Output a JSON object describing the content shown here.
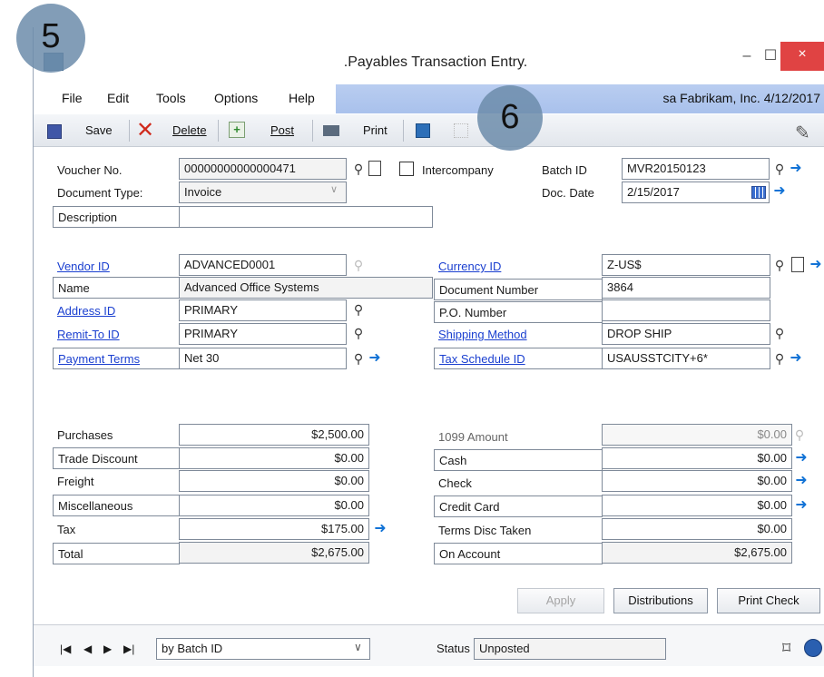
{
  "window": {
    "title": ".Payables Transaction Entry.",
    "minimize": "–",
    "maximize": "☐",
    "close": "×"
  },
  "menu": {
    "items": [
      "File",
      "Edit",
      "Tools",
      "Options",
      "Help"
    ],
    "user_info": "sa  Fabrikam, Inc.  4/12/2017"
  },
  "toolbar": {
    "save": "Save",
    "delete": "Delete",
    "post": "Post",
    "print": "Print"
  },
  "annotations": {
    "badge_a": "5",
    "badge_b": "6"
  },
  "header": {
    "voucher_label": "Voucher No.",
    "voucher_value": "00000000000000471",
    "intercompany_label": "Intercompany",
    "batch_label": "Batch ID",
    "batch_value": "MVR20150123",
    "doctype_label": "Document Type:",
    "doctype_value": "Invoice",
    "docdate_label": "Doc. Date",
    "docdate_value": "2/15/2017",
    "description_label": "Description",
    "description_value": ""
  },
  "vendor": {
    "vendor_id_label": "Vendor ID",
    "vendor_id_value": "ADVANCED0001",
    "name_label": "Name",
    "name_value": "Advanced Office Systems",
    "address_label": "Address ID",
    "address_value": "PRIMARY",
    "remit_label": "Remit-To ID",
    "remit_value": "PRIMARY",
    "terms_label": "Payment Terms",
    "terms_value": "Net 30",
    "currency_label": "Currency ID",
    "currency_value": "Z-US$",
    "docnum_label": "Document Number",
    "docnum_value": "3864",
    "po_label": "P.O. Number",
    "po_value": "",
    "shipping_label": "Shipping Method",
    "shipping_value": "DROP SHIP",
    "tax_sched_label": "Tax Schedule ID",
    "tax_sched_value": "USAUSSTCITY+6*"
  },
  "amounts_left": [
    {
      "label": "Purchases",
      "value": "$2,500.00"
    },
    {
      "label": "Trade Discount",
      "value": "$0.00"
    },
    {
      "label": "Freight",
      "value": "$0.00"
    },
    {
      "label": "Miscellaneous",
      "value": "$0.00"
    },
    {
      "label": "Tax",
      "value": "$175.00"
    },
    {
      "label": "Total",
      "value": "$2,675.00"
    }
  ],
  "amounts_right": [
    {
      "label": "1099 Amount",
      "value": "$0.00"
    },
    {
      "label": "Cash",
      "value": "$0.00"
    },
    {
      "label": "Check",
      "value": "$0.00"
    },
    {
      "label": "Credit Card",
      "value": "$0.00"
    },
    {
      "label": "Terms Disc Taken",
      "value": "$0.00"
    },
    {
      "label": "On Account",
      "value": "$2,675.00"
    }
  ],
  "buttons": {
    "apply": "Apply",
    "distributions": "Distributions",
    "print_check": "Print Check"
  },
  "footer": {
    "nav": [
      "|◀",
      "◀",
      "▶",
      "▶|"
    ],
    "sort_value": "by Batch ID",
    "status_label": "Status",
    "status_value": "Unposted"
  },
  "icons": [
    "lookup-icon",
    "note-icon",
    "expansion-arrow-icon",
    "calendar-icon",
    "save-icon",
    "delete-icon",
    "post-icon",
    "print-icon"
  ]
}
